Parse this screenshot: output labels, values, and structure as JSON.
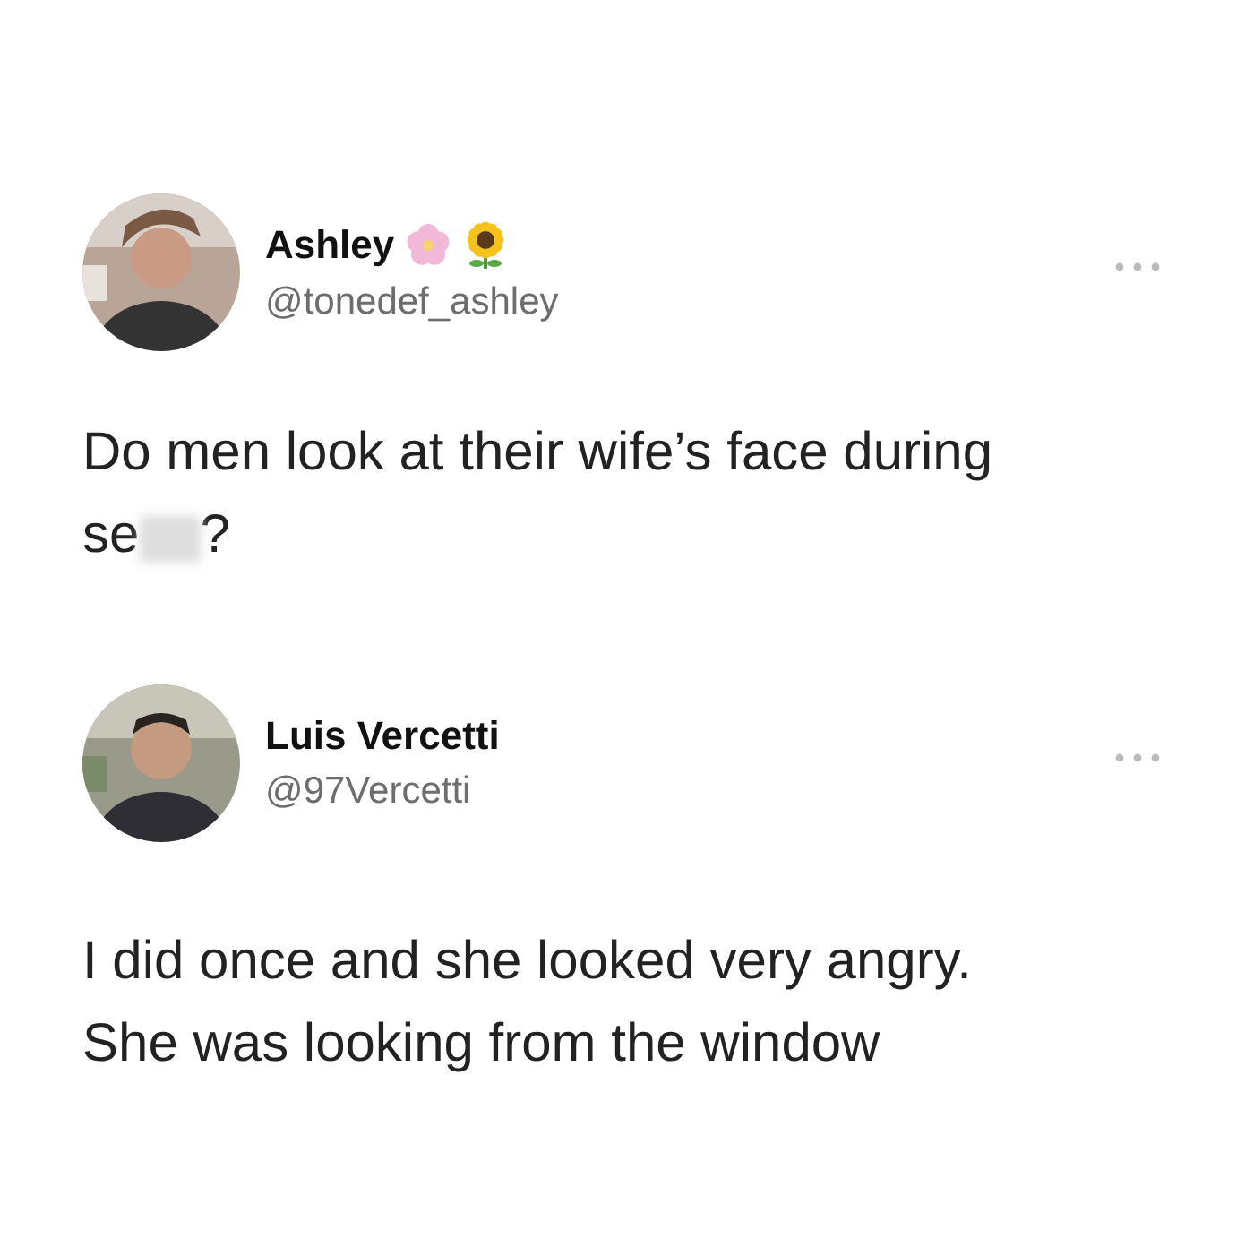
{
  "posts": [
    {
      "name": "Ashley",
      "handle": "@tonedef_ashley",
      "name_emoji": true,
      "avatar": {
        "kind": "picture"
      },
      "lines": [
        {
          "parts": [
            {
              "kind": "text",
              "text": "Do men look at their wife’s face during"
            }
          ]
        },
        {
          "parts": [
            {
              "kind": "text",
              "text": "se"
            },
            {
              "kind": "blur"
            },
            {
              "kind": "text",
              "text": "?"
            }
          ]
        }
      ]
    },
    {
      "name": "Luis Vercetti",
      "handle": "@97Vercetti",
      "name_emoji": false,
      "avatar": {
        "kind": "picture"
      },
      "lines": [
        {
          "parts": [
            {
              "kind": "text",
              "text": "I did once and she looked very angry."
            }
          ]
        },
        {
          "parts": [
            {
              "kind": "text",
              "text": "She was looking from the window"
            }
          ]
        }
      ]
    }
  ]
}
